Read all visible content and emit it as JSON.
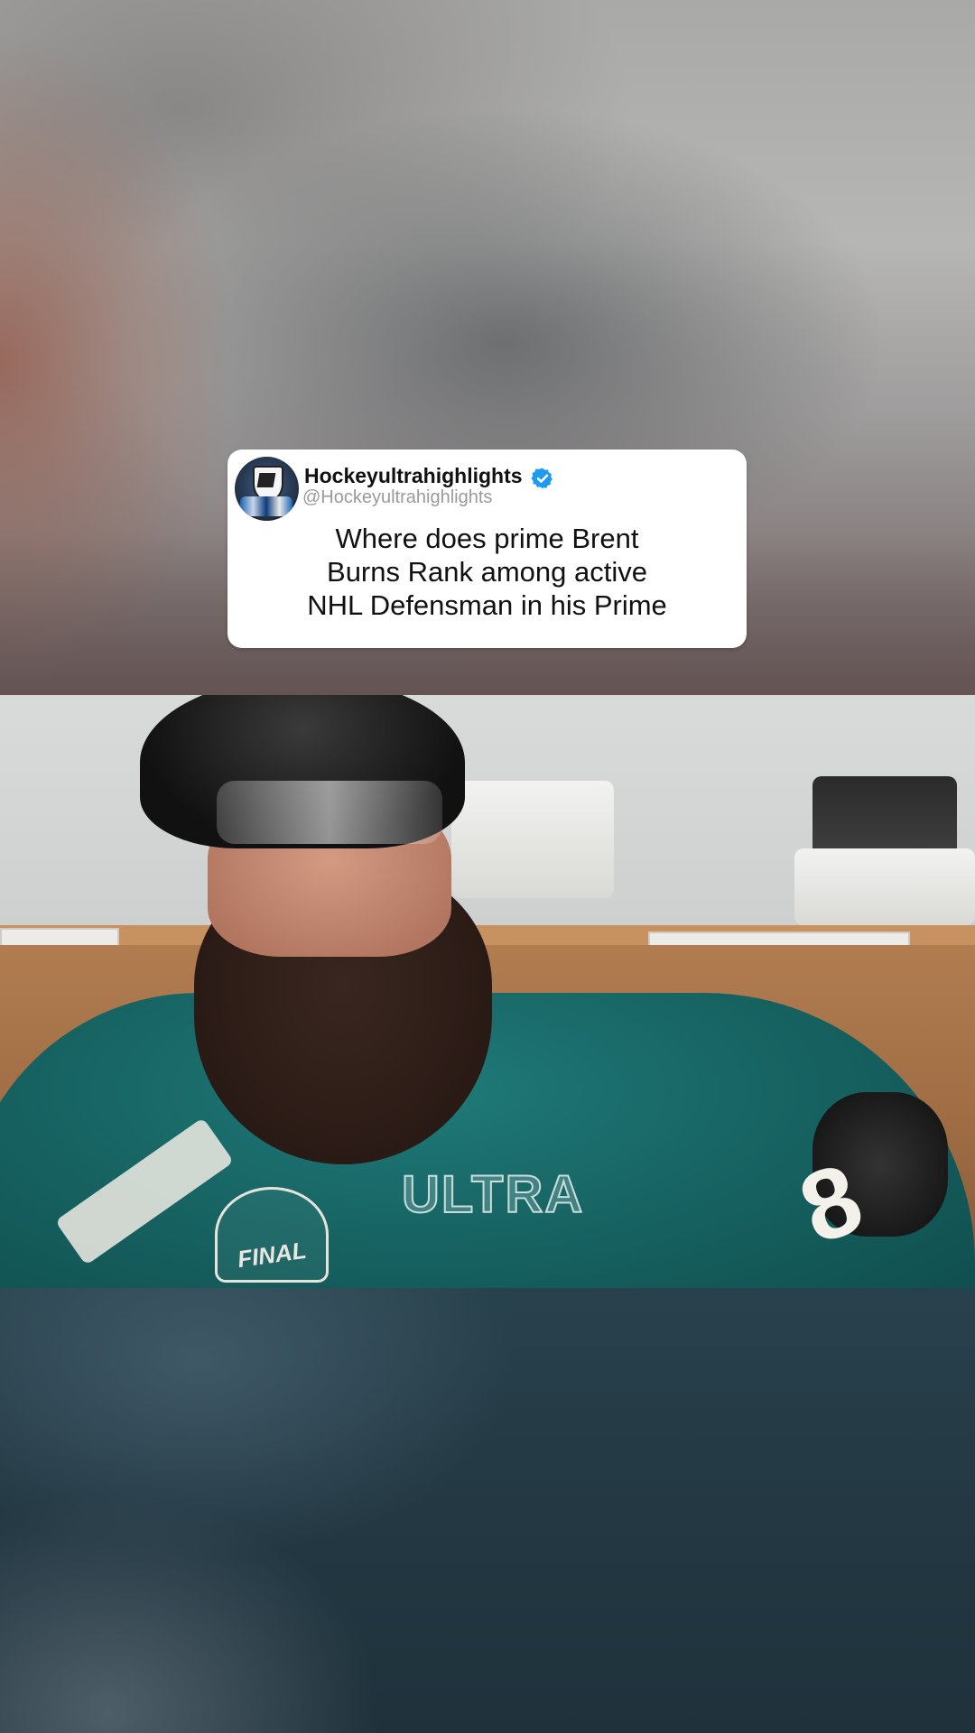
{
  "tweet": {
    "account_name": "Hockeyultrahighlights",
    "handle": "@Hockeyultrahighlights",
    "verified_icon": "verified-badge-icon",
    "avatar_icon": "nhl-logo-avatar",
    "text_lines": [
      "Where does prime Brent",
      "Burns Rank among active",
      "NHL Defensman in his Prime"
    ]
  },
  "video": {
    "watermark": "ULTRA",
    "logo_text": "FINAL",
    "jersey_number": "8"
  },
  "colors": {
    "verified": "#1d9bf0",
    "card_bg": "#ffffff",
    "jersey_teal": "#176463",
    "bottom_bg": "#233843"
  }
}
